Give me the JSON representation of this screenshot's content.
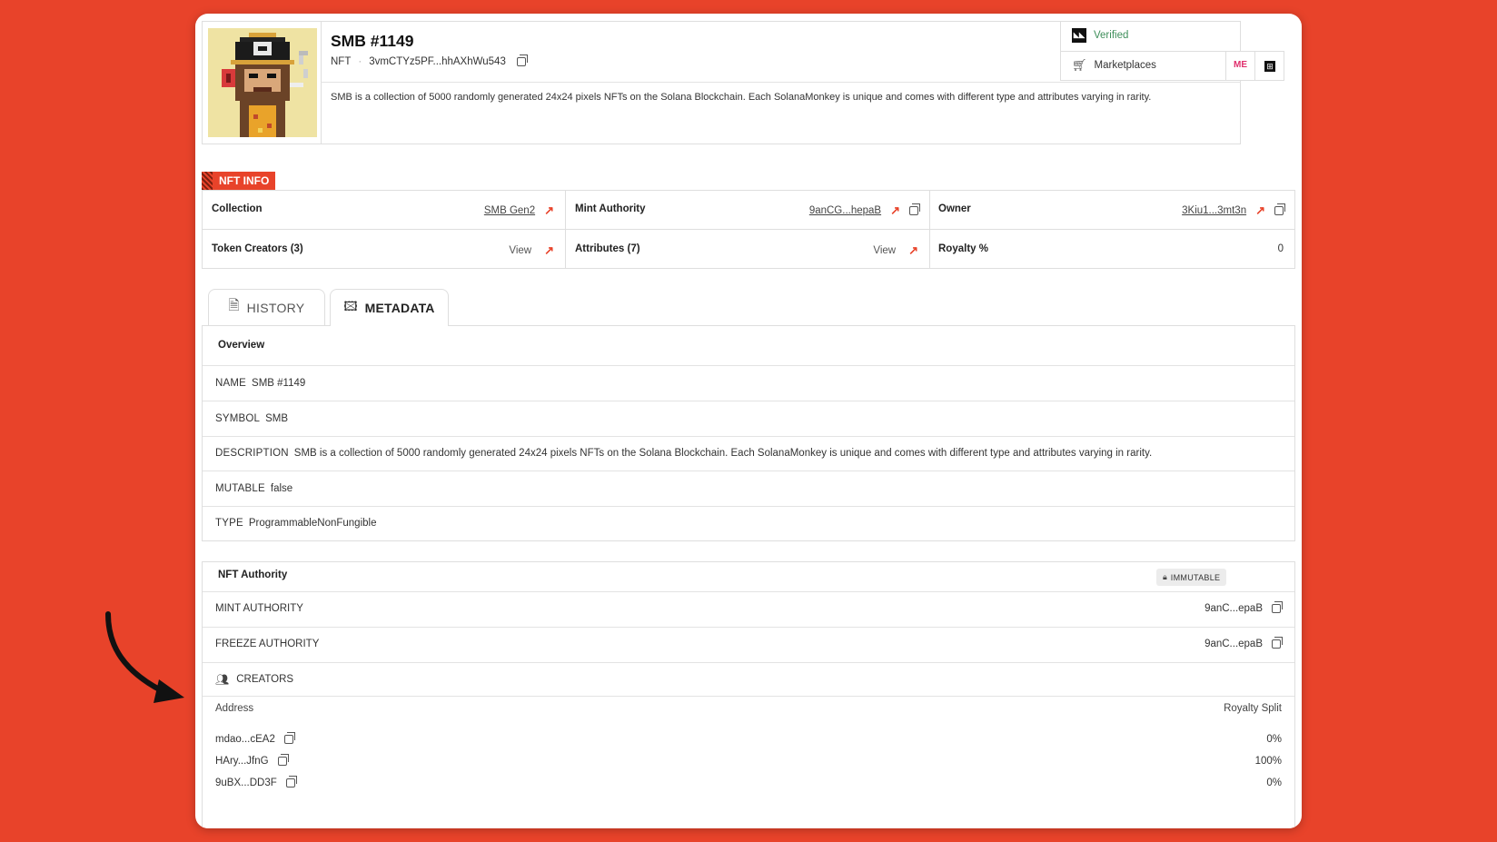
{
  "header": {
    "title": "SMB #1149",
    "type_label": "NFT",
    "address": "3vmCTYz5PF...hhAXhWu543",
    "description": "SMB is a collection of 5000 randomly generated 24x24 pixels NFTs on the Solana Blockchain. Each SolanaMonkey is unique and comes with different type and attributes varying in rarity.",
    "verified_label": "Verified",
    "marketplaces_label": "Marketplaces",
    "marketplace_icons": [
      "magic-eden-icon",
      "tensor-icon"
    ]
  },
  "nft_info": {
    "section_label": "NFT INFO",
    "collection": {
      "label": "Collection",
      "value": "SMB Gen2"
    },
    "mint_authority": {
      "label": "Mint Authority",
      "value": "9anCG...hepaB"
    },
    "owner": {
      "label": "Owner",
      "value": "3Kiu1...3mt3n"
    },
    "token_creators": {
      "label": "Token Creators (3)",
      "value": "View"
    },
    "attributes": {
      "label": "Attributes (7)",
      "value": "View"
    },
    "royalty": {
      "label": "Royalty %",
      "value": "0"
    }
  },
  "tabs": [
    {
      "label": "HISTORY",
      "icon": "document-icon"
    },
    {
      "label": "METADATA",
      "icon": "image-icon"
    }
  ],
  "overview": {
    "title": "Overview",
    "rows": [
      {
        "key": "NAME",
        "value": "SMB #1149"
      },
      {
        "key": "SYMBOL",
        "value": "SMB"
      },
      {
        "key": "DESCRIPTION",
        "value": "SMB is a collection of 5000 randomly generated 24x24 pixels NFTs on the Solana Blockchain. Each SolanaMonkey is unique and comes with different type and attributes varying in rarity."
      },
      {
        "key": "MUTABLE",
        "value": "false"
      },
      {
        "key": "TYPE",
        "value": "ProgrammableNonFungible"
      }
    ]
  },
  "authority": {
    "title": "NFT Authority",
    "badge": "IMMUTABLE",
    "mint": {
      "label": "MINT AUTHORITY",
      "value": "9anC...epaB"
    },
    "freeze": {
      "label": "FREEZE AUTHORITY",
      "value": "9anC...epaB"
    },
    "creators_label": "CREATORS",
    "col_address": "Address",
    "col_split": "Royalty Split",
    "creators": [
      {
        "address": "mdao...cEA2",
        "split": "0%"
      },
      {
        "address": "HAry...JfnG",
        "split": "100%"
      },
      {
        "address": "9uBX...DD3F",
        "split": "0%"
      }
    ]
  },
  "colors": {
    "background": "#e8432a",
    "accent": "#e8432a",
    "verified": "#3f8f5b"
  }
}
